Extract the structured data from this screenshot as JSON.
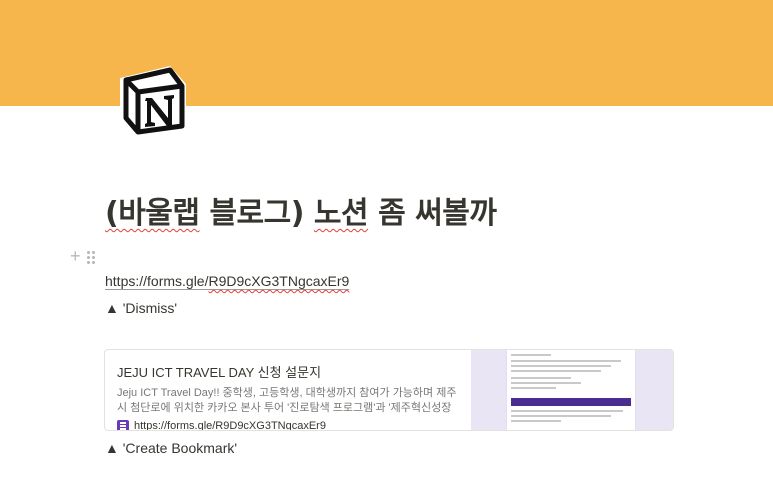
{
  "colors": {
    "cover": "#f6b64b",
    "form_icon": "#673ab7",
    "thumb_bg": "#e9e5f5",
    "thumb_bar": "#4b2c8f"
  },
  "page": {
    "icon": "notion-logo-icon",
    "title_part1": "(바울랩",
    "title_part2": " 블로그) ",
    "title_part3": "노션",
    "title_part4": " 좀 써볼까"
  },
  "block_handle": {
    "add_icon": "plus-icon",
    "drag_icon": "drag-handle-icon"
  },
  "link": {
    "prefix": "https://forms.gle/",
    "suffix": "R9D9cXG3TNgcaxEr9"
  },
  "notes": {
    "dismiss": "▲ 'Dismiss'",
    "create_bookmark": "▲ 'Create Bookmark'"
  },
  "bookmark": {
    "title": "JEJU ICT TRAVEL DAY 신청 설문지",
    "description": "Jeju ICT Travel Day!! 중학생, 고등학생, 대학생까지 참여가 가능하며 제주시 첨단로에 위치한 카카오 본사 투어 '진로탐색 프로그램'과 '제주혁신성장센터(프로젝트인피니티) 투",
    "url": "https://forms.gle/R9D9cXG3TNgcaxEr9",
    "favicon": "google-forms-icon"
  }
}
